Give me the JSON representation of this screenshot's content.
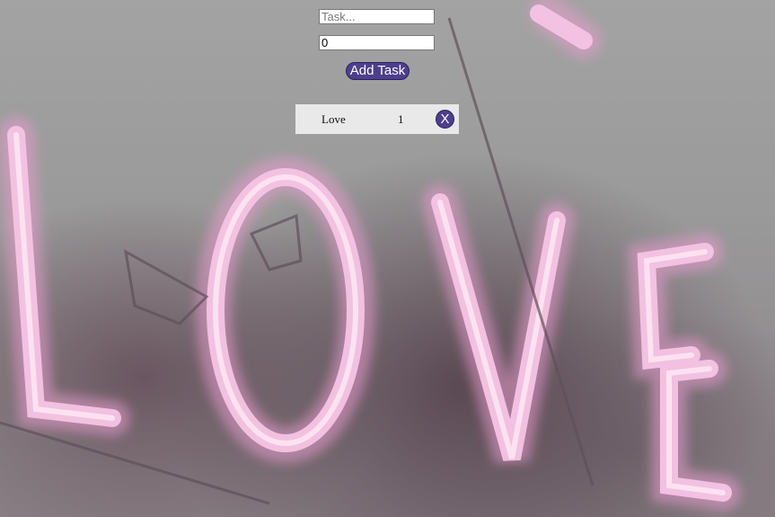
{
  "form": {
    "task_placeholder": "Task...",
    "count_value": "0",
    "add_button_label": "Add Task"
  },
  "tasks": [
    {
      "name": "Love",
      "count": "1",
      "delete_label": "X"
    }
  ],
  "colors": {
    "button": "#4d3f8c",
    "row_background": "#e9e9e9",
    "neon": "#f3b4dc"
  },
  "background": {
    "icon": "neon-love-sign-photo"
  }
}
